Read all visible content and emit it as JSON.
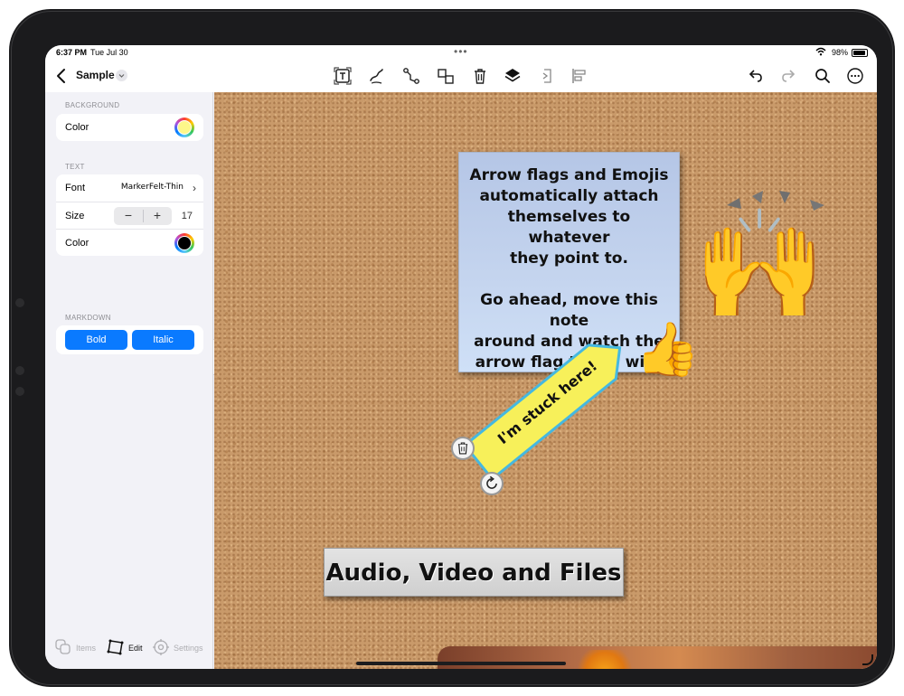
{
  "status_bar": {
    "time": "6:37 PM",
    "date": "Tue Jul 30",
    "battery": "98%"
  },
  "navbar": {
    "title": "Sample"
  },
  "sidebar": {
    "background": {
      "title": "BACKGROUND",
      "color_label": "Color",
      "color_value": "#fdf78a"
    },
    "text": {
      "title": "TEXT",
      "font_label": "Font",
      "font_value": "MarkerFelt-Thin",
      "size_label": "Size",
      "size_value": "17",
      "minus": "−",
      "plus": "+",
      "color_label": "Color",
      "color_value": "#000000"
    },
    "markdown": {
      "title": "MARKDOWN",
      "bold": "Bold",
      "italic": "Italic"
    },
    "tabs": [
      {
        "label": "Items"
      },
      {
        "label": "Edit"
      },
      {
        "label": "Settings"
      }
    ]
  },
  "canvas": {
    "note": {
      "lines_a": [
        "Arrow flags and Emojis",
        "automatically attach",
        "themselves to whatever",
        "they point to."
      ],
      "lines_b": [
        "Go ahead, move this note",
        "around and watch the",
        "arrow flag travel with it"
      ]
    },
    "arrow_flag": {
      "text": "I'm stuck here!",
      "fill": "#f7f05a",
      "border": "#45b8e0"
    },
    "emojis": {
      "raised_hands": "🙌",
      "thumbs_up": "👍"
    },
    "label_plate": "Audio, Video and Files"
  }
}
